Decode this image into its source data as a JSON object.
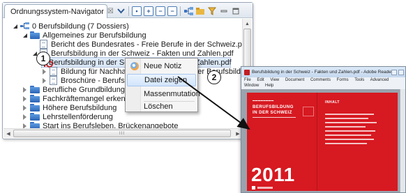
{
  "navigator": {
    "tab_title": "Ordnungssystem-Navigator",
    "tab_close": "☒",
    "toolbar_icons": [
      "chevron-down-icon",
      "collapse-all-icon",
      "expand-plus-icon",
      "expand-minus-icon",
      "minus-box-icon",
      "link-editor-icon",
      "folder-add-icon",
      "filter-icon",
      "minimize-icon",
      "maximize-icon"
    ],
    "tree": [
      {
        "label": "0 Berufsbildung (7 Dossiers)",
        "level": 1,
        "icon": "repository-icon",
        "expanded": true
      },
      {
        "label": "Allgemeines zur Berufsbildung",
        "level": 2,
        "icon": "folder-icon",
        "expanded": true
      },
      {
        "label": "Bericht des Bundesrates - Freie Berufe in der Schweiz.pdf",
        "level": 3,
        "icon": "document-icon"
      },
      {
        "label": "Berufsbildung in der Schweiz - Fakten und Zahlen.pdf",
        "level": 3,
        "icon": "document-icon",
        "expanded": true
      },
      {
        "label": "Berufsbildung in der Schweiz - Fakten und Zahlen.pdf",
        "level": 4,
        "icon": "pdf-icon",
        "selected": true
      },
      {
        "label": "Bildung für Nachhaltige Entwicklung in der Berufsbildung.pdf",
        "level": 3,
        "icon": "document-icon",
        "expanded": false
      },
      {
        "label": "Broschüre - Berufsbildung",
        "level": 3,
        "icon": "document-icon",
        "expanded": false
      },
      {
        "label": "Berufliche Grundbildung",
        "level": 2,
        "icon": "folder-icon",
        "expanded": false
      },
      {
        "label": "Fachkräftemangel erkennen",
        "level": 2,
        "icon": "folder-icon",
        "expanded": false
      },
      {
        "label": "Höhere Berufsbildung",
        "level": 2,
        "icon": "folder-icon",
        "expanded": false
      },
      {
        "label": "Lehrstellenförderung",
        "level": 2,
        "icon": "folder-icon",
        "expanded": false
      },
      {
        "label": "Start ins Berufsleben, Brückenangebote",
        "level": 2,
        "icon": "folder-icon",
        "expanded": false
      }
    ],
    "truncated_suffix_row5": "ng.pdf",
    "truncated_suffix_row4": "df",
    "hscroll_grip": "III"
  },
  "context_menu": {
    "items": [
      {
        "label": "Neue Notiz",
        "icon": "note-icon"
      },
      {
        "label": "Datei zeigen",
        "hover": true
      },
      {
        "label": "Massenmutation"
      },
      {
        "label": "Löschen"
      }
    ]
  },
  "markers": {
    "one": "1",
    "two": "2"
  },
  "pdf_viewer": {
    "title": "Berufsbildung in der Schweiz - Fakten und Zahlen.pdf - Adobe Reader",
    "menu": [
      "File",
      "Edit",
      "View",
      "Document",
      "Comments",
      "Forms",
      "Tools",
      "Advanced",
      "Window",
      "Help"
    ],
    "page": {
      "heading_line1": "BERUFSBILDUNG",
      "heading_line2": "IN DER SCHWEIZ",
      "year": "2011",
      "toc_title": "INHALT",
      "page_color": "#d71921"
    }
  },
  "colors": {
    "selection": "#dbe8f8",
    "accent": "#3b74c4",
    "pdf_red": "#d71921"
  }
}
